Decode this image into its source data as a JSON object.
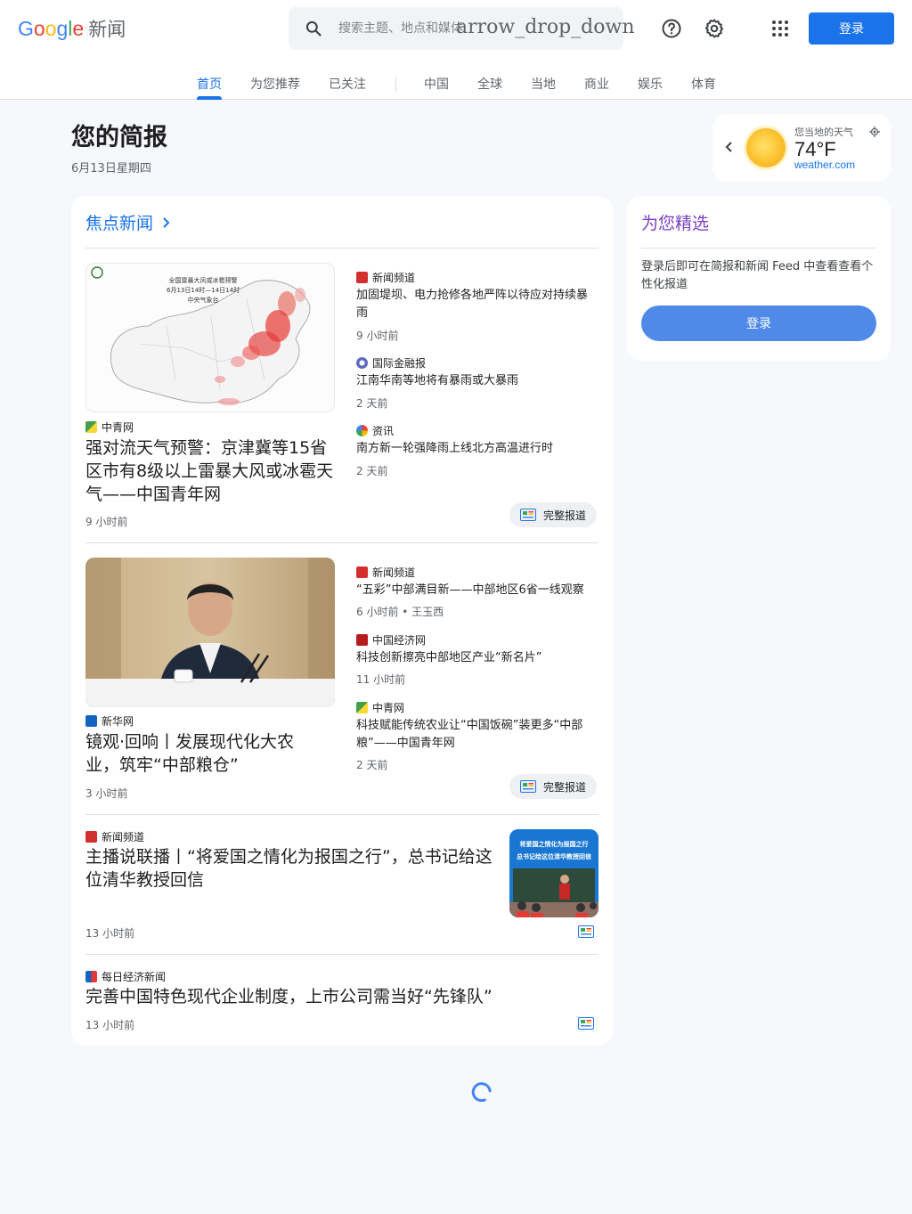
{
  "header": {
    "logo_text": "Google",
    "logo_suffix": "新闻",
    "search_placeholder": "搜索主题、地点和媒体",
    "search_overlay_text": "arrow_drop_down",
    "signin_label": "登录"
  },
  "nav": {
    "tabs": [
      {
        "label": "首页",
        "active": true
      },
      {
        "label": "为您推荐"
      },
      {
        "label": "已关注"
      },
      {
        "label": "中国"
      },
      {
        "label": "全球"
      },
      {
        "label": "当地"
      },
      {
        "label": "商业"
      },
      {
        "label": "娱乐"
      },
      {
        "label": "体育"
      }
    ]
  },
  "briefing": {
    "title": "您的简报",
    "date": "6月13日星期四"
  },
  "weather": {
    "label": "您当地的天气",
    "temperature": "74°F",
    "source": "weather.com",
    "icon": "sun-icon"
  },
  "top_stories": {
    "title": "焦点新闻",
    "full_coverage_label": "完整报道",
    "clusters": [
      {
        "main": {
          "publisher": "中青网",
          "headline": "强对流天气预警：京津冀等15省区市有8级以上雷暴大风或冰雹天气——中国青年网",
          "time": "9 小时前",
          "image_caption_lines": [
            "全国雷暴大风或冰雹预警",
            "6月13日14时—14日14时",
            "中央气象台"
          ]
        },
        "related": [
          {
            "publisher": "新闻频道",
            "headline": "加固堤坝、电力抢修各地严阵以待应对持续暴雨",
            "time": "9 小时前"
          },
          {
            "publisher": "国际金融报",
            "headline": "江南华南等地将有暴雨或大暴雨",
            "time": "2 天前"
          },
          {
            "publisher": "资讯",
            "headline": "南方新一轮强降雨上线北方高温进行时",
            "time": "2 天前"
          }
        ]
      },
      {
        "main": {
          "publisher": "新华网",
          "headline": "镜观·回响丨发展现代化大农业，筑牢“中部粮仓”",
          "time": "3 小时前"
        },
        "related": [
          {
            "publisher": "新闻频道",
            "headline": "“五彩”中部满目新——中部地区6省一线观察",
            "time": "6 小时前 • 王玉西"
          },
          {
            "publisher": "中国经济网",
            "headline": "科技创新擦亮中部地区产业“新名片”",
            "time": "11 小时前"
          },
          {
            "publisher": "中青网",
            "headline": "科技赋能传统农业让“中国饭碗”装更多“中部粮”——中国青年网",
            "time": "2 天前"
          }
        ]
      }
    ],
    "singles": [
      {
        "publisher": "新闻频道",
        "headline": "主播说联播丨“将爱国之情化为报国之行”，总书记给这位清华教授回信",
        "time": "13 小时前",
        "image_lines": [
          "将爱国之情化为报国之行",
          "总书记给这位清华教授回信"
        ]
      },
      {
        "publisher": "每日经济新闻",
        "headline": "完善中国特色现代企业制度，上市公司需当好“先锋队”",
        "time": "13 小时前"
      }
    ]
  },
  "picks": {
    "title": "为您精选",
    "text": "登录后即可在简报和新闻 Feed 中查看查看个性化报道",
    "button": "登录"
  },
  "colors": {
    "accent": "#1a73e8",
    "picks_title": "#7b3fc4"
  }
}
